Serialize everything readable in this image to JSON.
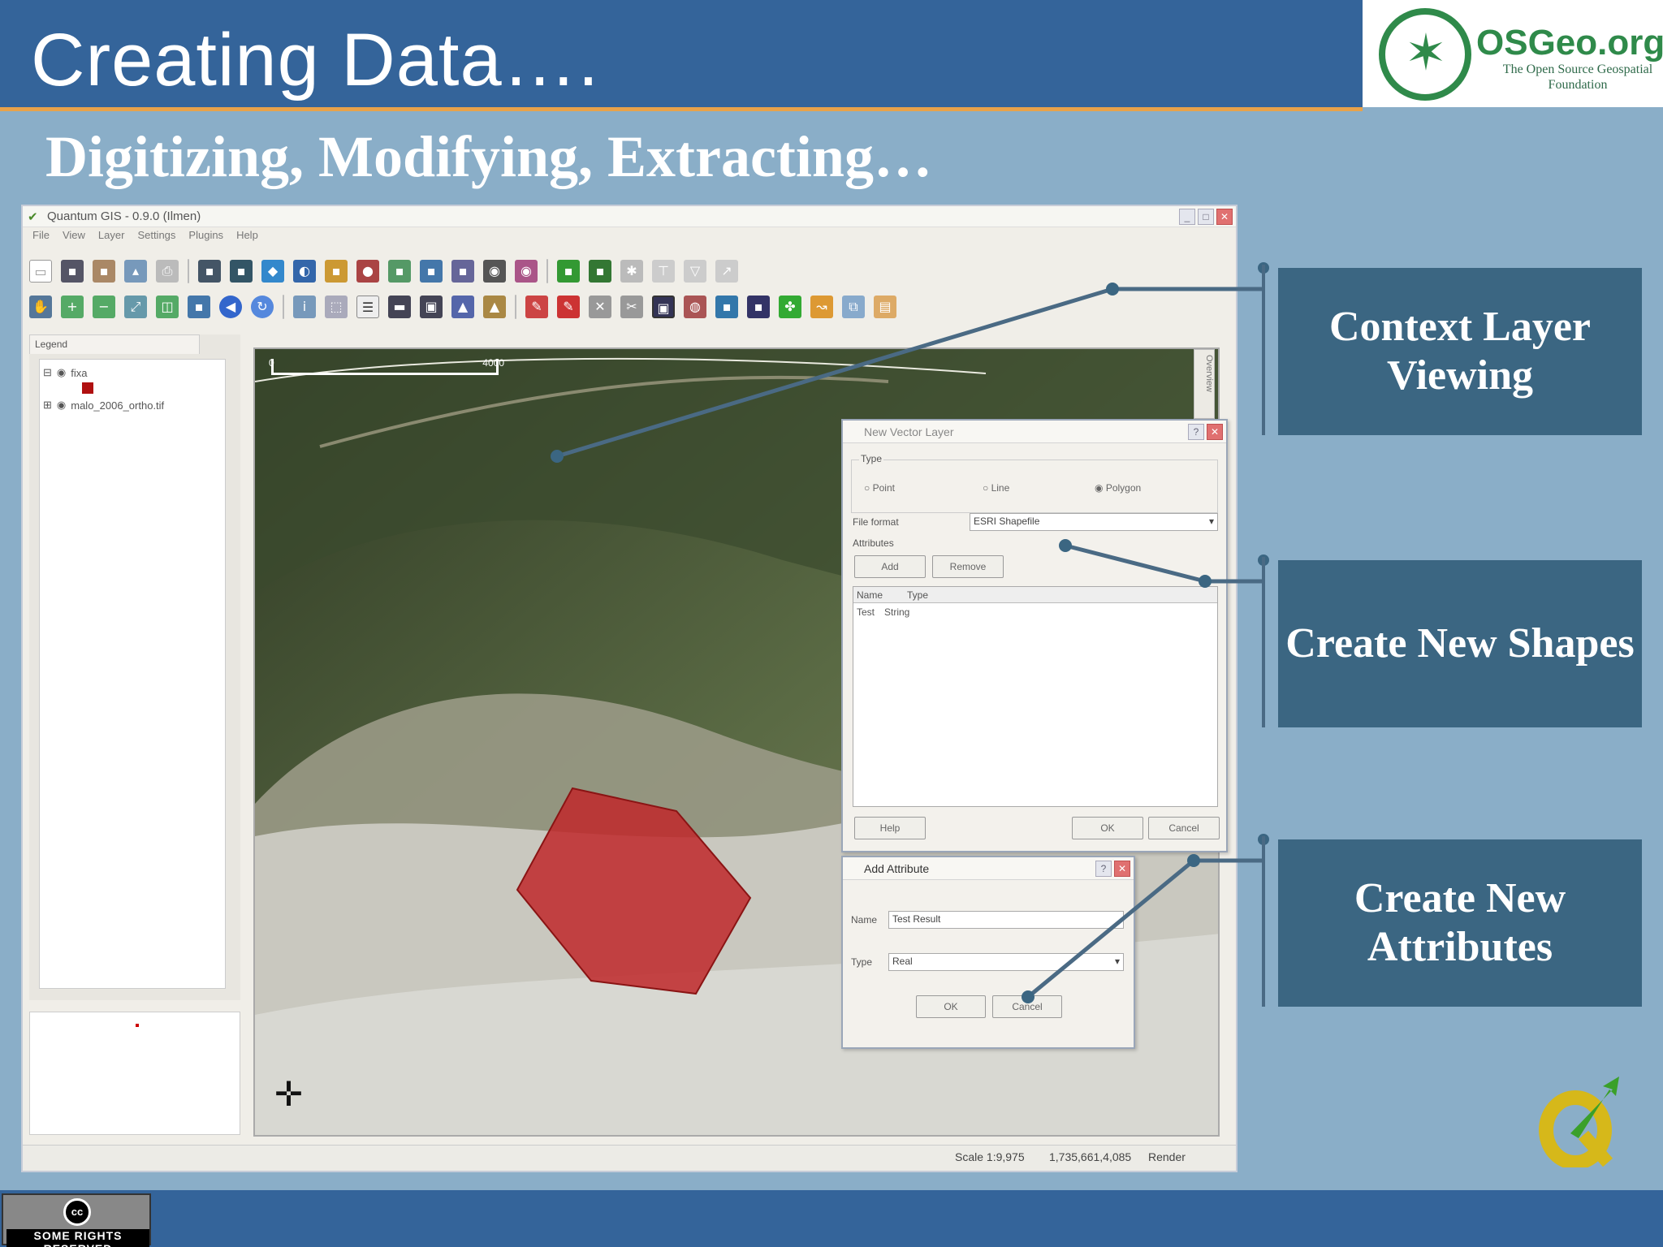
{
  "slide": {
    "title": "Creating Data….",
    "subtitle": "Digitizing, Modifying, Extracting…"
  },
  "logo": {
    "name": "OSGeo.org",
    "tagline": "The Open Source Geospatial Foundation",
    "color": "#2f8a4a"
  },
  "app": {
    "window_title": "Quantum GIS - 0.9.0 (Ilmen)",
    "menus": [
      "File",
      "View",
      "Layer",
      "Settings",
      "Plugins",
      "Help"
    ],
    "legend_tab": "Legend",
    "legend_items": [
      {
        "label": "fixa"
      },
      {
        "label": "malo_2006_ortho.tif"
      }
    ],
    "side_tab": "Overview",
    "scale_start": "0",
    "scale_end": "4000",
    "status": {
      "scale": "Scale 1:9,975",
      "coords": "1,735,661,4,085",
      "render": "Render"
    }
  },
  "new_vector_dialog": {
    "title": "New Vector Layer",
    "type_label": "Type",
    "type_options": [
      "Point",
      "Line",
      "Polygon"
    ],
    "selected_type": "Polygon",
    "file_format_label": "File format",
    "file_format_value": "ESRI Shapefile",
    "attributes_label": "Attributes",
    "add_button": "Add",
    "remove_button": "Remove",
    "columns": [
      "Name",
      "Type"
    ],
    "rows": [
      [
        "Test",
        "String"
      ]
    ],
    "help_button": "Help",
    "ok_button": "OK",
    "cancel_button": "Cancel"
  },
  "add_attr_dialog": {
    "title": "Add Attribute",
    "name_label": "Name",
    "name_value": "Test Result",
    "type_label": "Type",
    "type_value": "Real",
    "ok_button": "OK",
    "cancel_button": "Cancel"
  },
  "callouts": [
    {
      "text": "Context Layer Viewing"
    },
    {
      "text": "Create New Shapes"
    },
    {
      "text": "Create New Attributes"
    }
  ],
  "license": {
    "icon": "cc",
    "text": "SOME RIGHTS RESERVED"
  },
  "colors": {
    "header": "#34649a",
    "accent_rule": "#e8a24a",
    "callout_bg": "#3b6682",
    "polygon_fill": "#c0282a"
  }
}
